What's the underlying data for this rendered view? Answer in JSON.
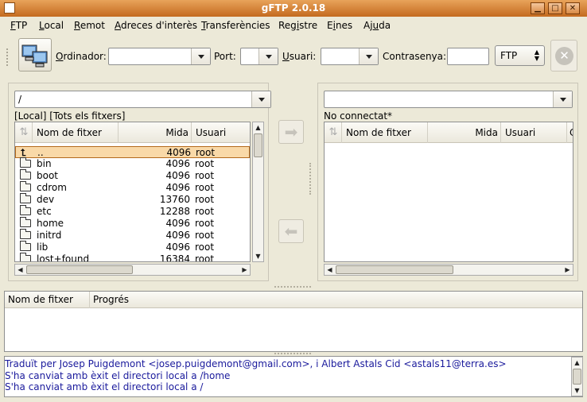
{
  "window": {
    "title": "gFTP 2.0.18"
  },
  "menubar": {
    "items": [
      {
        "label_u": "F",
        "label_rest": "TP"
      },
      {
        "label_u": "L",
        "label_rest": "ocal"
      },
      {
        "label_u": "R",
        "label_rest": "emot"
      },
      {
        "label_u": "A",
        "label_rest": "dreces d'interès"
      },
      {
        "label_u": "T",
        "label_rest": "ransferències"
      },
      {
        "label_pre": "Reg",
        "label_u": "i",
        "label_rest": "stre"
      },
      {
        "label_pre": "E",
        "label_u": "i",
        "label_rest": "nes"
      },
      {
        "label_pre": "Aj",
        "label_u": "u",
        "label_rest": "da"
      }
    ]
  },
  "toolbar": {
    "host_label_u": "O",
    "host_label_rest": "rdinador:",
    "host_value": "",
    "port_label": "Port:",
    "port_value": "",
    "user_label_u": "U",
    "user_label_rest": "suari:",
    "user_value": "",
    "password_label": "Contrasenya:",
    "password_value": "",
    "protocol_value": "FTP"
  },
  "local": {
    "path": "/",
    "label": "[Local] [Tots els fitxers]",
    "columns": {
      "name": "Nom de fitxer",
      "size": "Mida",
      "user": "Usuari"
    },
    "files": [
      {
        "name": "..",
        "size": "4096",
        "user": "root",
        "selected": true,
        "icon": "up-arrow-icon"
      },
      {
        "name": "bin",
        "size": "4096",
        "user": "root",
        "icon": "folder-icon"
      },
      {
        "name": "boot",
        "size": "4096",
        "user": "root",
        "icon": "folder-icon"
      },
      {
        "name": "cdrom",
        "size": "4096",
        "user": "root",
        "icon": "folder-icon"
      },
      {
        "name": "dev",
        "size": "13760",
        "user": "root",
        "icon": "folder-icon"
      },
      {
        "name": "etc",
        "size": "12288",
        "user": "root",
        "icon": "folder-icon"
      },
      {
        "name": "home",
        "size": "4096",
        "user": "root",
        "icon": "folder-icon"
      },
      {
        "name": "initrd",
        "size": "4096",
        "user": "root",
        "icon": "folder-icon"
      },
      {
        "name": "lib",
        "size": "4096",
        "user": "root",
        "icon": "folder-icon"
      },
      {
        "name": "lost+found",
        "size": "16384",
        "user": "root",
        "icon": "folder-icon"
      }
    ]
  },
  "remote": {
    "path": "",
    "label": "No connectat*",
    "columns": {
      "name": "Nom de fitxer",
      "size": "Mida",
      "user": "Usuari",
      "extra": "C"
    }
  },
  "queue": {
    "columns": {
      "name": "Nom de fitxer",
      "progress": "Progrés"
    }
  },
  "log": {
    "lines": [
      "Traduït per Josep Puigdemont <josep.puigdemont@gmail.com>, i Albert Astals Cid <astals11@terra.es>",
      "S'ha canviat amb èxit el directori local a /home",
      "S'ha canviat amb èxit el directori local a /"
    ]
  },
  "colors": {
    "titlebar": "#d9833b",
    "selection": "#f9d9a8",
    "log_text": "#1a1a9c"
  }
}
